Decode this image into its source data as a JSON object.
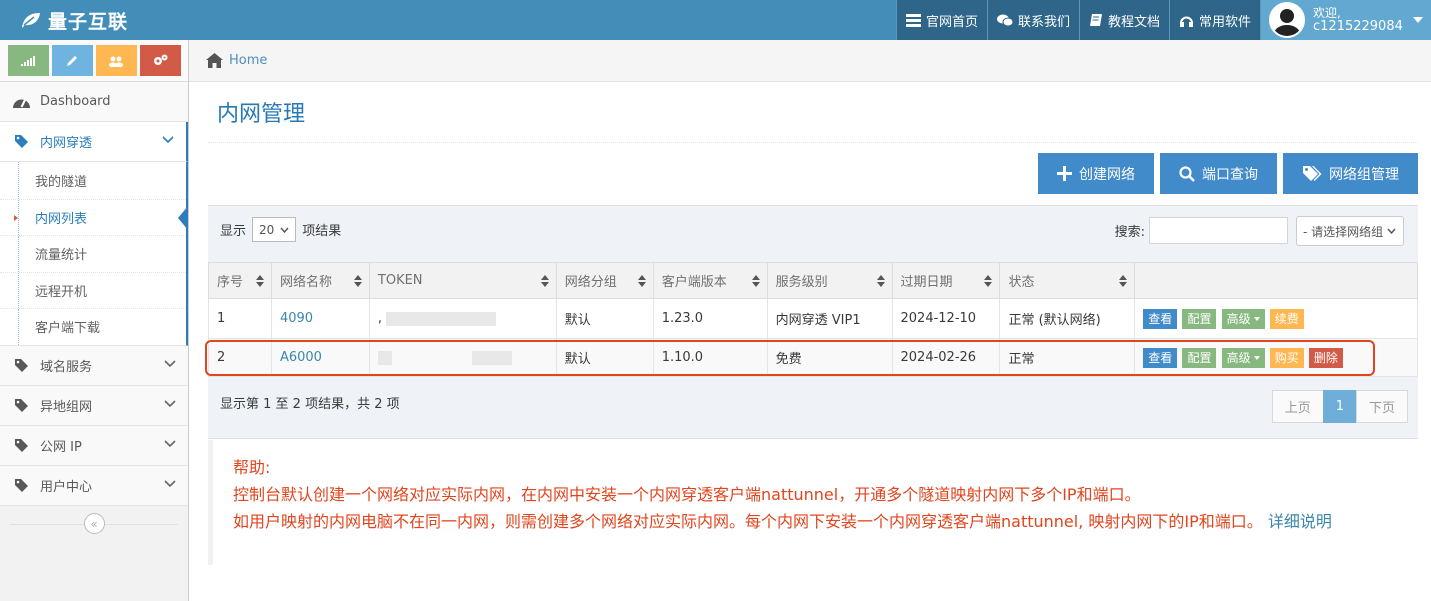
{
  "navbar": {
    "brand": "量子互联",
    "items": [
      {
        "label": "官网首页",
        "icon": "list-icon"
      },
      {
        "label": "联系我们",
        "icon": "chat-icon"
      },
      {
        "label": "教程文档",
        "icon": "book-icon"
      },
      {
        "label": "常用软件",
        "icon": "headset-icon"
      }
    ],
    "user": {
      "welcome": "欢迎,",
      "name": "c1215229084"
    }
  },
  "sidebar": {
    "menu": [
      {
        "label": "Dashboard",
        "icon": "dashboard-icon"
      },
      {
        "label": "内网穿透",
        "icon": "tag-icon"
      },
      {
        "label": "域名服务",
        "icon": "tag-icon"
      },
      {
        "label": "异地组网",
        "icon": "tag-icon"
      },
      {
        "label": "公网 IP",
        "icon": "tag-icon"
      },
      {
        "label": "用户中心",
        "icon": "tag-icon"
      }
    ],
    "submenu": [
      "我的隧道",
      "内网列表",
      "流量统计",
      "远程开机",
      "客户端下载"
    ],
    "collapse": "«"
  },
  "breadcrumb": {
    "home": "Home"
  },
  "page": {
    "title": "内网管理"
  },
  "actions": {
    "create": "创建网络",
    "port_query": "端口查询",
    "group_manage": "网络组管理"
  },
  "table_controls": {
    "show_prefix": "显示",
    "page_size": "20",
    "show_suffix": "项结果",
    "search_label": "搜索:",
    "group_placeholder": "- 请选择网络组"
  },
  "table": {
    "headers": [
      "序号",
      "网络名称",
      "TOKEN",
      "网络分组",
      "客户端版本",
      "服务级别",
      "过期日期",
      "状态",
      ""
    ],
    "rows": [
      {
        "index": "1",
        "name": "4090",
        "token": ",",
        "group": "默认",
        "version": "1.23.0",
        "level": "内网穿透 VIP1",
        "expire": "2024-12-10",
        "status": "正常 (默认网络)",
        "buttons": [
          "查看",
          "配置",
          "高级",
          "续费"
        ]
      },
      {
        "index": "2",
        "name": "A6000",
        "token": "",
        "group": "默认",
        "version": "1.10.0",
        "level": "免费",
        "expire": "2024-02-26",
        "status": "正常",
        "buttons": [
          "查看",
          "配置",
          "高级",
          "购买",
          "删除"
        ]
      }
    ]
  },
  "footer": {
    "info": "显示第 1 至 2 项结果，共 2 项",
    "prev": "上页",
    "page": "1",
    "next": "下页"
  },
  "help": {
    "title": "帮助:",
    "line1": "控制台默认创建一个网络对应实际内网，在内网中安装一个内网穿透客户端nattunnel，开通多个隧道映射内网下多个IP和端口。",
    "line2": "如用户映射的内网电脑不在同一内网，则需创建多个网络对应实际内网。每个内网下安装一个内网穿透客户端nattunnel, 映射内网下的IP和端口。",
    "link": "详细说明"
  },
  "colors": {
    "navbar": "#438eb9",
    "accent": "#2b7dbc",
    "help_text": "#e0451e",
    "highlight": "#e0451e"
  }
}
